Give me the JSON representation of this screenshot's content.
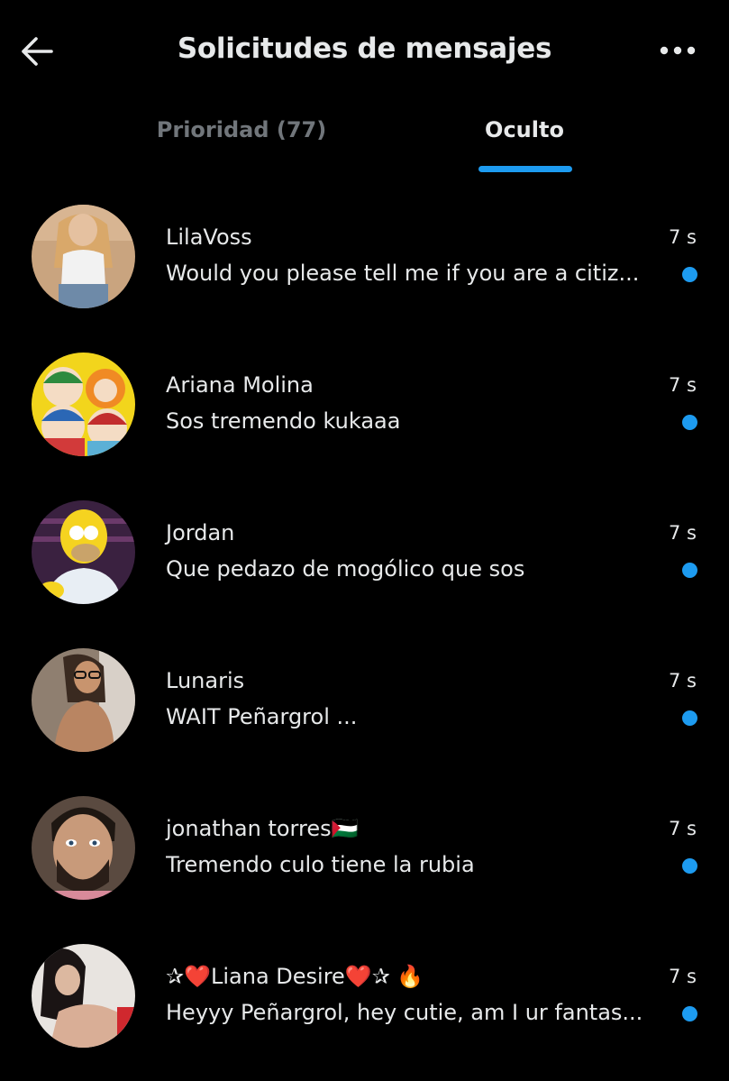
{
  "header": {
    "title": "Solicitudes de mensajes",
    "back_icon": "arrow-left-icon",
    "more_icon": "ellipsis-icon"
  },
  "tabs": [
    {
      "label": "Prioridad (77)",
      "active": false
    },
    {
      "label": "Oculto",
      "active": true
    }
  ],
  "colors": {
    "accent": "#1d9bf0",
    "background": "#000000",
    "text": "#e7e9ea",
    "muted": "#71767b"
  },
  "messages": [
    {
      "name": "LilaVoss",
      "preview": "Would you please tell me if you are a citiz...",
      "time": "7 s",
      "unread": true,
      "avatar": "photo-woman-white-top"
    },
    {
      "name": "Ariana Molina",
      "preview": "Sos tremendo kukaaa",
      "time": "7 s",
      "unread": true,
      "avatar": "cartoon-south-park"
    },
    {
      "name": "Jordan",
      "preview": "Que pedazo de mogólico que sos",
      "time": "7 s",
      "unread": true,
      "avatar": "cartoon-homer"
    },
    {
      "name": "Lunaris",
      "preview": "WAIT Peñargrol ...",
      "time": "7 s",
      "unread": true,
      "avatar": "photo-woman-glasses"
    },
    {
      "name": "jonathan torres🇵🇸",
      "preview": "Tremendo culo tiene la rubia",
      "time": "7 s",
      "unread": true,
      "avatar": "photo-man-beard"
    },
    {
      "name": "✰❤️Liana Desire❤️✰ 🔥",
      "preview": "Heyyy Peñargrol, hey cutie, am I ur fantas...",
      "time": "7 s",
      "unread": true,
      "avatar": "photo-woman-dark-hair"
    }
  ]
}
